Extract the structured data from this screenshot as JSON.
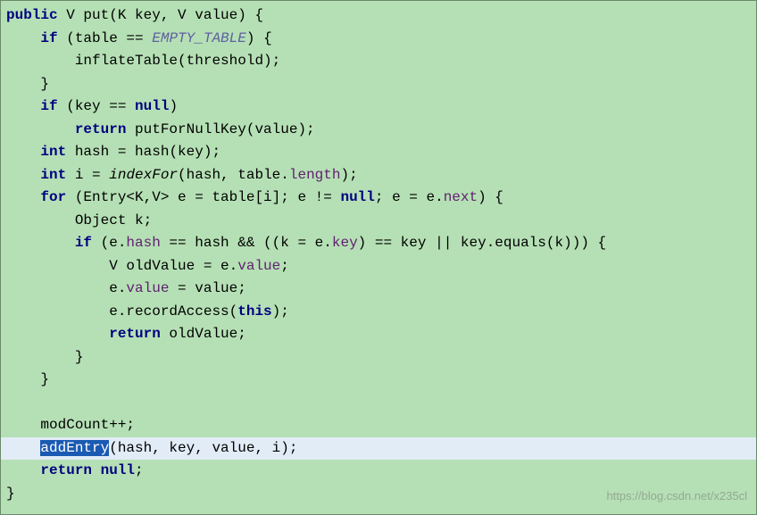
{
  "code": {
    "l1a": "public",
    "l1b": " V put(K key, V value) {",
    "l2a": "    ",
    "l2b": "if",
    "l2c": " (table == ",
    "l2d": "EMPTY_TABLE",
    "l2e": ") {",
    "l3": "        inflateTable(threshold);",
    "l4": "    }",
    "l5a": "    ",
    "l5b": "if",
    "l5c": " (key == ",
    "l5d": "null",
    "l5e": ")",
    "l6a": "        ",
    "l6b": "return",
    "l6c": " putForNullKey(value);",
    "l7a": "    ",
    "l7b": "int",
    "l7c": " hash = hash(key);",
    "l8a": "    ",
    "l8b": "int",
    "l8c": " i = ",
    "l8d": "indexFor",
    "l8e": "(hash, table.",
    "l8f": "length",
    "l8g": ");",
    "l9a": "    ",
    "l9b": "for",
    "l9c": " (Entry<K,V> e = table[i]; e != ",
    "l9d": "null",
    "l9e": "; e = e.",
    "l9f": "next",
    "l9g": ") {",
    "l10": "        Object k;",
    "l11a": "        ",
    "l11b": "if",
    "l11c": " (e.",
    "l11d": "hash",
    "l11e": " == hash && ((k = e.",
    "l11f": "key",
    "l11g": ") == key || key.equals(k))) {",
    "l12a": "            V oldValue = e.",
    "l12b": "value",
    "l12c": ";",
    "l13a": "            e.",
    "l13b": "value",
    "l13c": " = value;",
    "l14a": "            e.recordAccess(",
    "l14b": "this",
    "l14c": ");",
    "l15a": "            ",
    "l15b": "return",
    "l15c": " oldValue;",
    "l16": "        }",
    "l17": "    }",
    "l18": " ",
    "l19": "    modCount++;",
    "l20a": "    ",
    "l20b": "addEntry",
    "l20c": "(hash, key, value, i);",
    "l21a": "    ",
    "l21b": "return null",
    "l21c": ";",
    "l22": "}"
  },
  "watermark": "https://blog.csdn.net/x235cl"
}
